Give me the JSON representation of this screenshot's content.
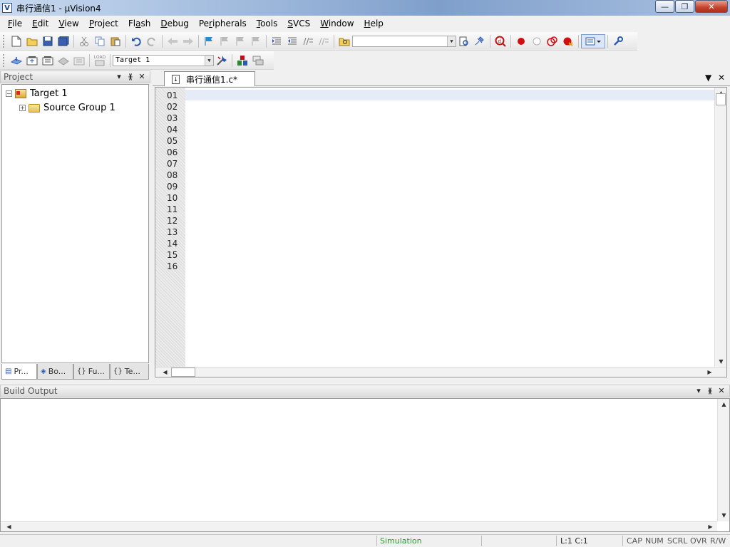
{
  "window": {
    "title": "串行通信1 - μVision4",
    "app_icon": "V",
    "minimize_glyph": "—",
    "maximize_glyph": "❐",
    "close_glyph": "✕"
  },
  "menu": [
    {
      "pre": "",
      "ul": "F",
      "post": "ile"
    },
    {
      "pre": "",
      "ul": "E",
      "post": "dit"
    },
    {
      "pre": "",
      "ul": "V",
      "post": "iew"
    },
    {
      "pre": "",
      "ul": "P",
      "post": "roject"
    },
    {
      "pre": "Fl",
      "ul": "a",
      "post": "sh"
    },
    {
      "pre": "",
      "ul": "D",
      "post": "ebug"
    },
    {
      "pre": "Pe",
      "ul": "r",
      "post": "ipherals"
    },
    {
      "pre": "",
      "ul": "T",
      "post": "ools"
    },
    {
      "pre": "",
      "ul": "S",
      "post": "VCS"
    },
    {
      "pre": "",
      "ul": "W",
      "post": "indow"
    },
    {
      "pre": "",
      "ul": "H",
      "post": "elp"
    }
  ],
  "toolbar2": {
    "load_label": "LOAD",
    "target_combo": "Target 1"
  },
  "project_panel": {
    "title": "Project",
    "tree": {
      "target": "Target 1",
      "group": "Source Group 1"
    },
    "tabs": [
      "Pr...",
      "Bo...",
      "Fu...",
      "Te..."
    ]
  },
  "editor": {
    "tab_label": "串行通信1.c*",
    "line_numbers": [
      "01",
      "02",
      "03",
      "04",
      "05",
      "06",
      "07",
      "08",
      "09",
      "10",
      "11",
      "12",
      "13",
      "14",
      "15",
      "16"
    ]
  },
  "build_output": {
    "title": "Build Output"
  },
  "status": {
    "mode": "Simulation",
    "cursor": "L:1 C:1",
    "cap": "CAP",
    "num": "NUM",
    "scrl": "SCRL",
    "ovr": "OVR",
    "rw": "R/W"
  },
  "colors": {
    "simulation_text": "#2a9a2a",
    "breakpoint": "#d01010"
  }
}
